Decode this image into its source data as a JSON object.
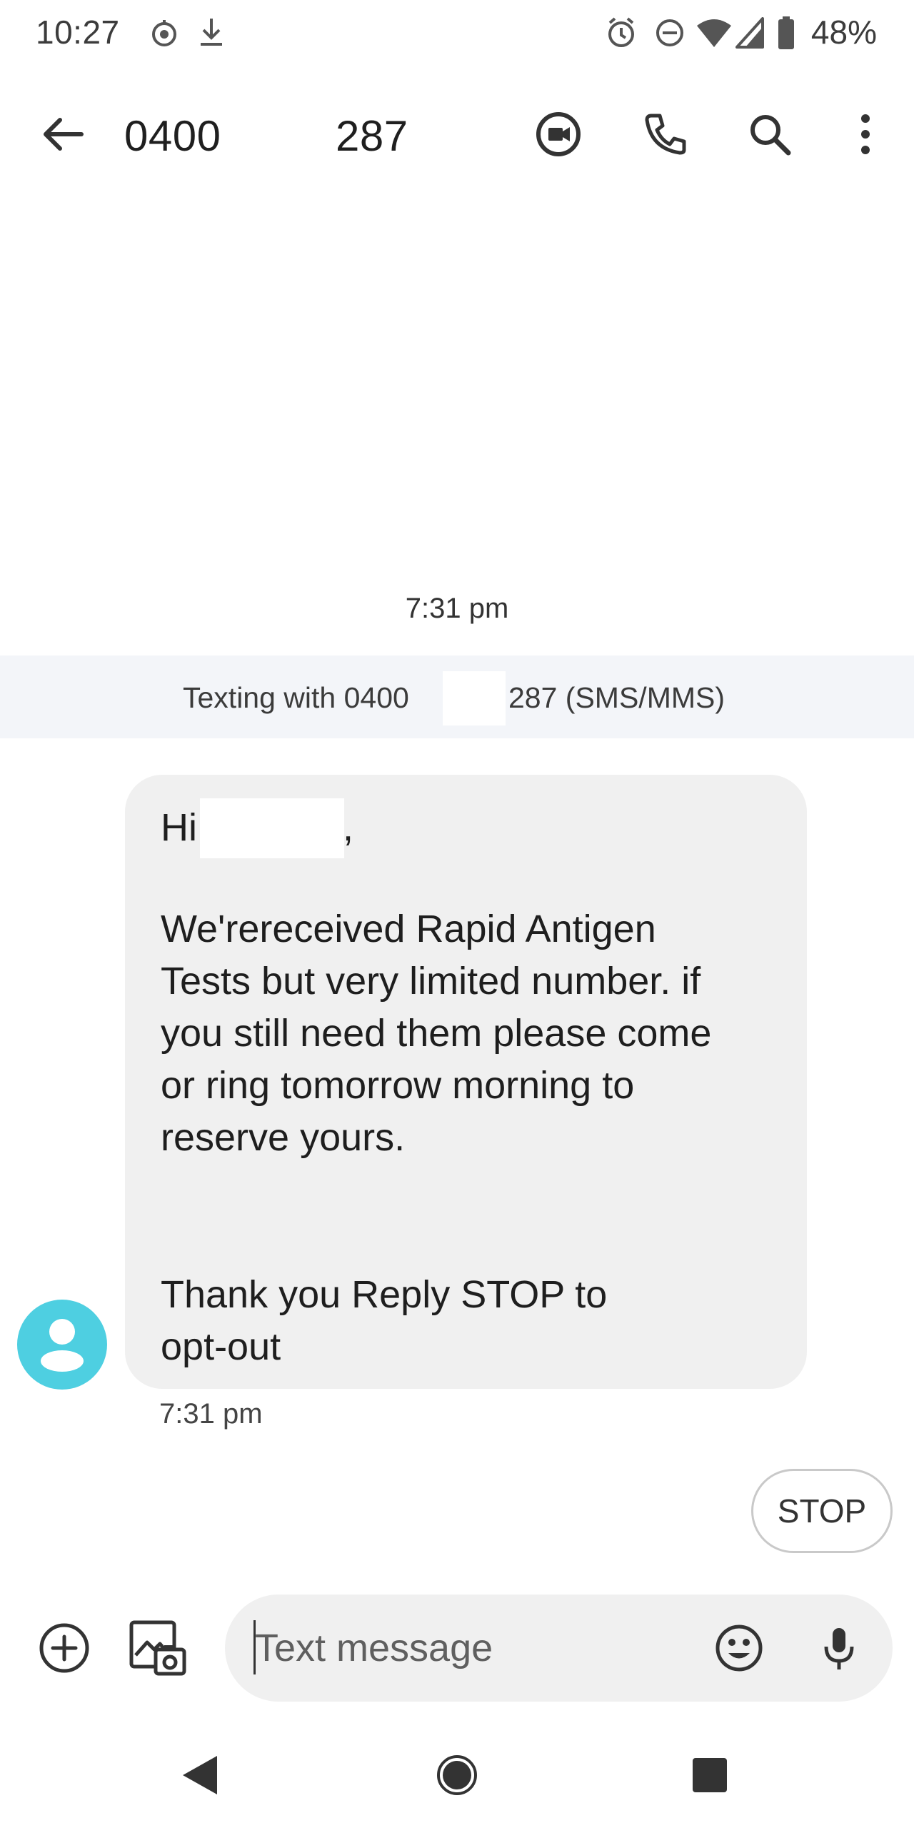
{
  "status_bar": {
    "time": "10:27",
    "battery_percent": "48%",
    "icons": [
      "data-saver-icon",
      "download-icon",
      "alarm-icon",
      "do-not-disturb-icon",
      "wifi-icon",
      "cell-signal-icon",
      "battery-icon"
    ]
  },
  "app_bar": {
    "contact_prefix": "0400",
    "contact_suffix": "287",
    "icons": [
      "back-arrow-icon",
      "video-call-icon",
      "phone-icon",
      "search-icon",
      "more-vert-icon"
    ]
  },
  "conversation": {
    "divider_time": "7:31 pm",
    "banner": {
      "prefix": "Texting with 0400",
      "suffix": "287 (SMS/MMS)"
    },
    "message": {
      "lines": [
        "Hi",
        ",",
        "We'rereceived Rapid Antigen",
        "Tests but very limited number. if",
        "you still need them please come",
        "or ring tomorrow morning to",
        "reserve yours.",
        "Thank you Reply STOP to",
        "opt-out"
      ],
      "time": "7:31 pm",
      "avatar_color": "#4ecfe1",
      "bubble_color": "#f0f0f0"
    },
    "smart_reply": "STOP"
  },
  "compose": {
    "placeholder": "Text message",
    "icons": [
      "add-icon",
      "gallery-icon",
      "emoji-icon",
      "mic-icon"
    ]
  },
  "nav_bar": {
    "icons": [
      "nav-back-icon",
      "nav-home-icon",
      "nav-recents-icon"
    ]
  }
}
